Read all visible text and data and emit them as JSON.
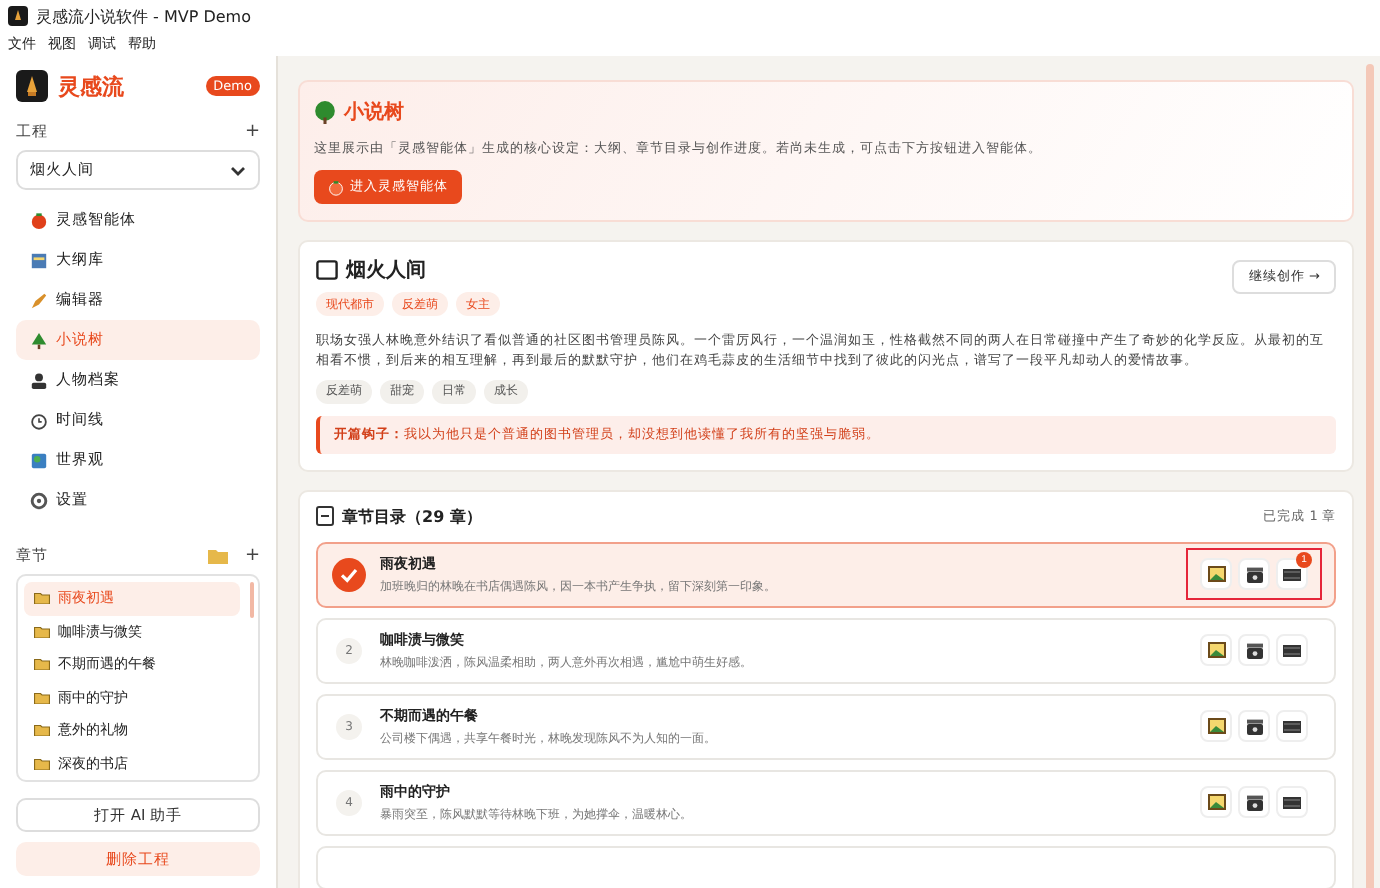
{
  "window": {
    "title": "灵感流小说软件 - MVP Demo"
  },
  "menu": [
    "文件",
    "视图",
    "调试",
    "帮助"
  ],
  "sidebar": {
    "brand": "灵感流",
    "badge": "Demo",
    "project_label": "工程",
    "project_add": "+",
    "project_select": "烟火人间",
    "nav": [
      {
        "label": "灵感智能体",
        "selected": false
      },
      {
        "label": "大纲库",
        "selected": false
      },
      {
        "label": "编辑器",
        "selected": false
      },
      {
        "label": "小说树",
        "selected": true
      },
      {
        "label": "人物档案",
        "selected": false
      },
      {
        "label": "时间线",
        "selected": false
      },
      {
        "label": "世界观",
        "selected": false
      },
      {
        "label": "设置",
        "selected": false
      }
    ],
    "chapters_label": "章节",
    "chapters_add": "+",
    "chapters": [
      {
        "title": "雨夜初遇",
        "selected": true
      },
      {
        "title": "咖啡渍与微笑",
        "selected": false
      },
      {
        "title": "不期而遇的午餐",
        "selected": false
      },
      {
        "title": "雨中的守护",
        "selected": false
      },
      {
        "title": "意外的礼物",
        "selected": false
      },
      {
        "title": "深夜的书店",
        "selected": false
      }
    ],
    "ai_button": "打开 AI 助手",
    "delete_button": "删除工程"
  },
  "intro": {
    "title": "小说树",
    "text": "这里展示由「灵感智能体」生成的核心设定：大纲、章节目录与创作进度。若尚未生成，可点击下方按钮进入智能体。",
    "button": "进入灵感智能体"
  },
  "novel": {
    "title": "烟火人间",
    "genres": [
      "现代都市",
      "反差萌",
      "女主"
    ],
    "continue_button": "继续创作 →",
    "synopsis": "职场女强人林晚意外结识了看似普通的社区图书管理员陈风。一个雷厉风行，一个温润如玉，性格截然不同的两人在日常碰撞中产生了奇妙的化学反应。从最初的互相看不惯，到后来的相互理解，再到最后的默默守护，他们在鸡毛蒜皮的生活细节中找到了彼此的闪光点，谱写了一段平凡却动人的爱情故事。",
    "tags": [
      "反差萌",
      "甜宠",
      "日常",
      "成长"
    ],
    "hook_label": "开篇钩子：",
    "hook": "我以为他只是个普通的图书管理员，却没想到他读懂了我所有的坚强与脆弱。"
  },
  "catalog": {
    "title": "章节目录（29 章）",
    "progress": "已完成 1 章",
    "rows": [
      {
        "title": "雨夜初遇",
        "summary": "加班晚归的林晚在书店偶遇陈风，因一本书产生争执，留下深刻第一印象。",
        "done": true,
        "highlighted": true,
        "badge": "1"
      },
      {
        "number": "2",
        "title": "咖啡渍与微笑",
        "summary": "林晚咖啡泼洒，陈风温柔相助，两人意外再次相遇，尴尬中萌生好感。",
        "done": false,
        "highlighted": false
      },
      {
        "number": "3",
        "title": "不期而遇的午餐",
        "summary": "公司楼下偶遇，共享午餐时光，林晚发现陈风不为人知的一面。",
        "done": false,
        "highlighted": false
      },
      {
        "number": "4",
        "title": "雨中的守护",
        "summary": "暴雨突至，陈风默默等待林晚下班，为她撑伞，温暖林心。",
        "done": false,
        "highlighted": false
      }
    ]
  }
}
